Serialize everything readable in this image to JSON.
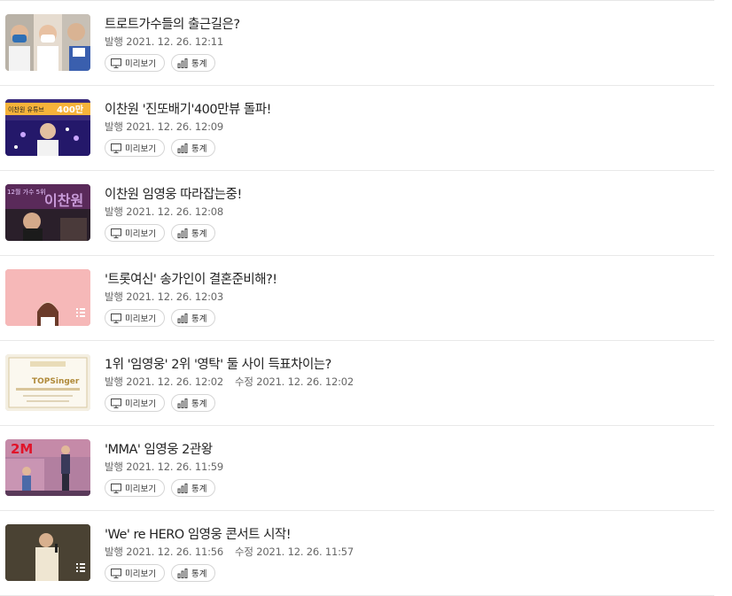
{
  "colors": {
    "divider": "#e9e9e9",
    "title": "#222222",
    "meta": "#666666",
    "button_border": "#d5d5d5"
  },
  "buttons": {
    "preview": "미리보기",
    "stats": "통계"
  },
  "articles": [
    {
      "title": "트로트가수들의 출근길은?",
      "published_label": "발행",
      "published": "2021. 12. 26. 12:11",
      "modified_label": "",
      "modified": "",
      "thumbnail_text": ""
    },
    {
      "title": "이찬원 '진또배기'400만뷰 돌파!",
      "published_label": "발행",
      "published": "2021. 12. 26. 12:09",
      "modified_label": "",
      "modified": "",
      "thumbnail_text": "이찬원 유튜브 400만"
    },
    {
      "title": "이찬원 임영웅 따라잡는중!",
      "published_label": "발행",
      "published": "2021. 12. 26. 12:08",
      "modified_label": "",
      "modified": "",
      "thumbnail_text": "12월 가수 5위 이찬원"
    },
    {
      "title": "'트롯여신' 송가인이 결혼준비해?!",
      "published_label": "발행",
      "published": "2021. 12. 26. 12:03",
      "modified_label": "",
      "modified": "",
      "thumbnail_text": ""
    },
    {
      "title": "1위 '임영웅' 2위 '영탁' 둘 사이 득표차이는?",
      "published_label": "발행",
      "published": "2021. 12. 26. 12:02",
      "modified_label": "수정",
      "modified": "2021. 12. 26. 12:02",
      "thumbnail_text": "TOPSinger"
    },
    {
      "title": "'MMA' 임영웅 2관왕",
      "published_label": "발행",
      "published": "2021. 12. 26. 11:59",
      "modified_label": "",
      "modified": "",
      "thumbnail_text": "2M"
    },
    {
      "title": "'We' re HERO 임영웅 콘서트 시작!",
      "published_label": "발행",
      "published": "2021. 12. 26. 11:56",
      "modified_label": "수정",
      "modified": "2021. 12. 26. 11:57",
      "thumbnail_text": ""
    }
  ]
}
